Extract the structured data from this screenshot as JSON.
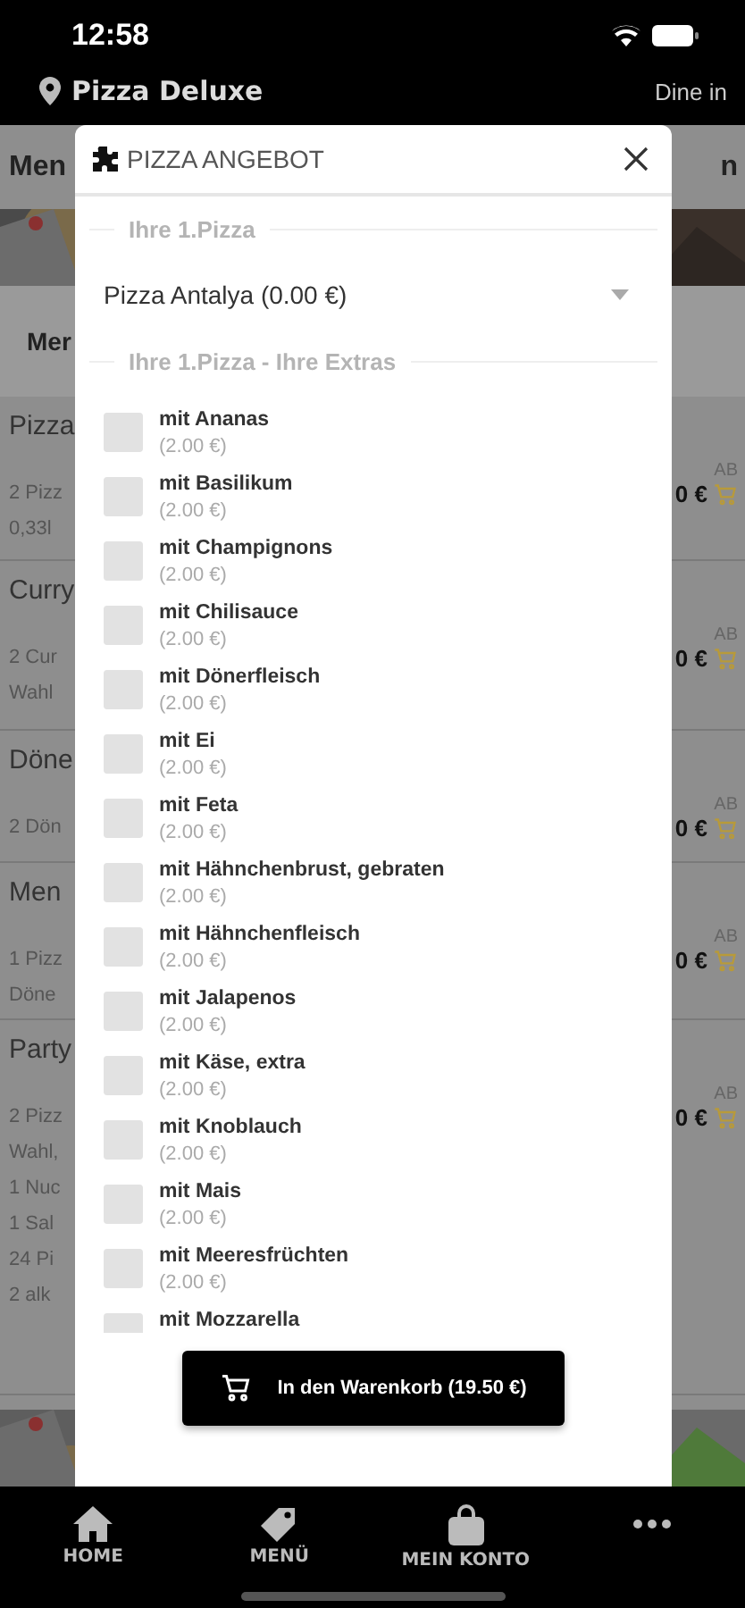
{
  "status_bar": {
    "time": "12:58"
  },
  "header": {
    "store": "Pizza Deluxe",
    "mode": "Dine in"
  },
  "background": {
    "heading_left": "Men",
    "heading_right": "n",
    "subtab": "Mer",
    "sections": [
      {
        "title": "Pizza",
        "lines": [
          "2 Pizz",
          "0,33l"
        ],
        "price": {
          "prefix": "AB",
          "amount": "0 €"
        }
      },
      {
        "title": "Curry",
        "lines": [
          "2 Cur",
          "Wahl"
        ],
        "price": {
          "prefix": "AB",
          "amount": "0 €"
        }
      },
      {
        "title": "Döne",
        "lines": [
          "2 Dön"
        ],
        "price": {
          "prefix": "AB",
          "amount": "0 €"
        }
      },
      {
        "title": "Men",
        "lines": [
          "1 Pizz",
          "Döne"
        ],
        "price": {
          "prefix": "AB",
          "amount": "0 €"
        }
      },
      {
        "title": "Party",
        "lines": [
          "2 Pizz",
          "Wahl,",
          "1 Nuc",
          "1 Sal",
          "24 Pi",
          "2 alk"
        ],
        "price": {
          "prefix": "AB",
          "amount": "0 €"
        }
      }
    ]
  },
  "dialog": {
    "title": "PIZZA ANGEBOT",
    "legend_1": "Ihre 1.Pizza",
    "select_value": "Pizza Antalya (0.00 €)",
    "legend_2": "Ihre 1.Pizza - Ihre Extras",
    "extras": [
      {
        "name": "mit Ananas",
        "price": "(2.00 €)",
        "checked": false
      },
      {
        "name": "mit Basilikum",
        "price": "(2.00 €)",
        "checked": false
      },
      {
        "name": "mit Champignons",
        "price": "(2.00 €)",
        "checked": false
      },
      {
        "name": "mit Chilisauce",
        "price": "(2.00 €)",
        "checked": false
      },
      {
        "name": "mit Dönerfleisch",
        "price": "(2.00 €)",
        "checked": false
      },
      {
        "name": "mit Ei",
        "price": "(2.00 €)",
        "checked": false
      },
      {
        "name": "mit Feta",
        "price": "(2.00 €)",
        "checked": false
      },
      {
        "name": "mit Hähnchenbrust, gebraten",
        "price": "(2.00 €)",
        "checked": false
      },
      {
        "name": "mit Hähnchenfleisch",
        "price": "(2.00 €)",
        "checked": false
      },
      {
        "name": "mit Jalapenos",
        "price": "(2.00 €)",
        "checked": false
      },
      {
        "name": "mit Käse, extra",
        "price": "(2.00 €)",
        "checked": false
      },
      {
        "name": "mit Knoblauch",
        "price": "(2.00 €)",
        "checked": false
      },
      {
        "name": "mit Mais",
        "price": "(2.00 €)",
        "checked": false
      },
      {
        "name": "mit Meeresfrüchten",
        "price": "(2.00 €)",
        "checked": false
      },
      {
        "name": "mit Mozzarella",
        "checked": false
      }
    ],
    "cart_button": "In den Warenkorb (19.50 €)"
  },
  "nav": [
    {
      "kind": "home",
      "label": "HOME"
    },
    {
      "kind": "tag",
      "label": "MENÜ"
    },
    {
      "kind": "bag",
      "label": "MEIN KONTO"
    },
    {
      "kind": "more"
    }
  ]
}
